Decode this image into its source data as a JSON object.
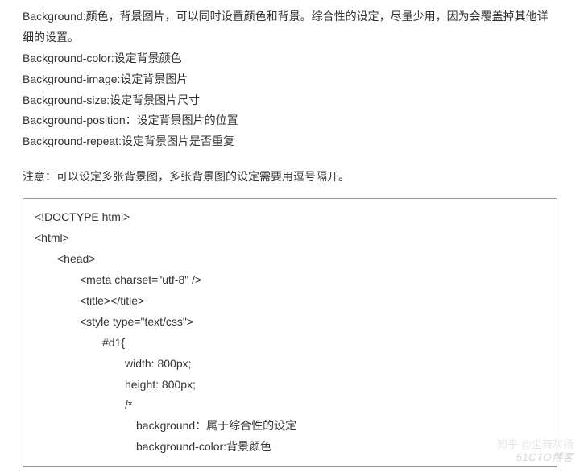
{
  "prose": {
    "lines": [
      "Background:颜色，背景图片，可以同时设置颜色和背景。综合性的设定，尽量少用，因为会覆盖掉其他详细的设置。",
      "Background-color:设定背景颜色",
      "Background-image:设定背景图片",
      "Background-size:设定背景图片尺寸",
      "Background-position：设定背景图片的位置",
      "Background-repeat:设定背景图片是否重复"
    ]
  },
  "note": "注意：可以设定多张背景图，多张背景图的设定需要用逗号隔开。",
  "code": {
    "lines": [
      {
        "indent": 0,
        "text": "<!DOCTYPE html>"
      },
      {
        "indent": 0,
        "text": "<html>"
      },
      {
        "indent": 1,
        "text": "<head>"
      },
      {
        "indent": 2,
        "text": "<meta charset=\"utf-8\" />"
      },
      {
        "indent": 2,
        "text": "<title></title>"
      },
      {
        "indent": 2,
        "text": "<style type=\"text/css\">"
      },
      {
        "indent": 3,
        "text": "#d1{"
      },
      {
        "indent": 4,
        "text": "width: 800px;"
      },
      {
        "indent": 4,
        "text": "height: 800px;"
      },
      {
        "indent": 4,
        "text": "/*"
      },
      {
        "indent": 5,
        "text": "background：属于综合性的设定"
      },
      {
        "indent": 5,
        "text": "background-color:背景颜色"
      }
    ]
  },
  "watermark_top": "知乎 @尘舞灰扬",
  "watermark_bottom": "51CTO博客"
}
